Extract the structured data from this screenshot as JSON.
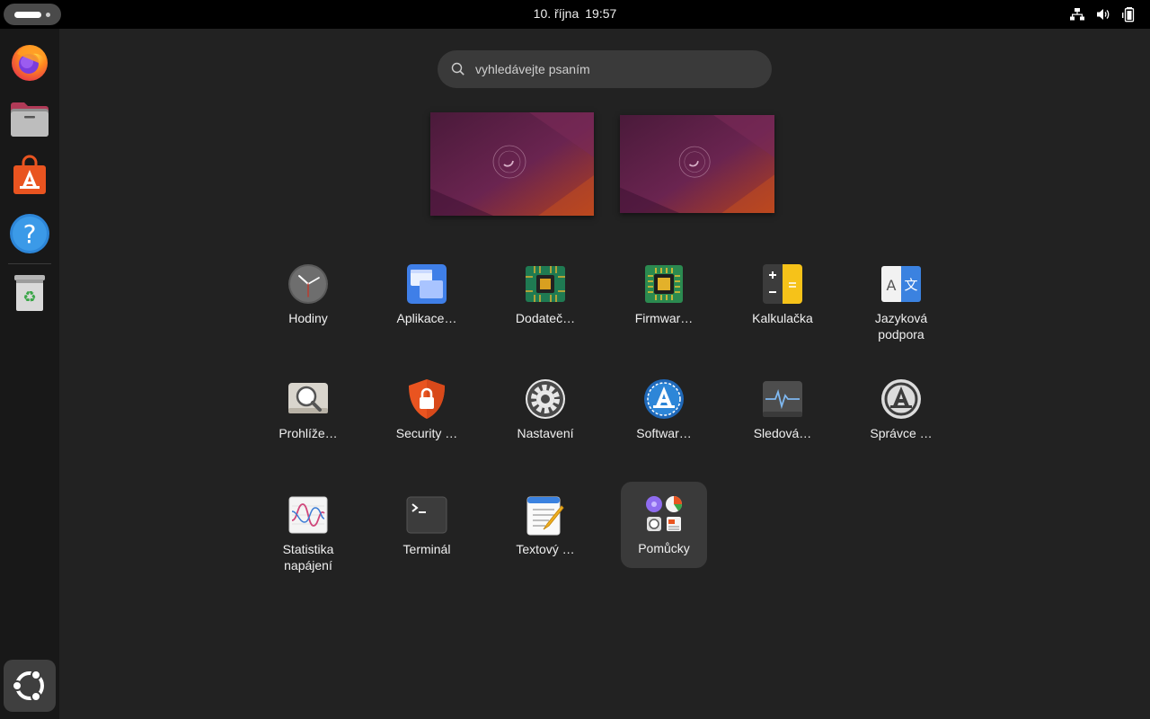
{
  "topbar": {
    "date": "10. října",
    "time": "19:57",
    "tray_icons": [
      "network-wired-icon",
      "volume-icon",
      "battery-icon"
    ]
  },
  "dock": {
    "items": [
      {
        "name": "Firefox",
        "icon": "firefox-icon"
      },
      {
        "name": "Soubory",
        "icon": "files-icon"
      },
      {
        "name": "App Center",
        "icon": "app-center-icon"
      },
      {
        "name": "Nápověda",
        "icon": "help-icon"
      },
      {
        "name": "Koš",
        "icon": "trash-icon"
      }
    ],
    "show_apps_icon": "ubuntu-show-apps-icon"
  },
  "search": {
    "placeholder": "vyhledávejte psaním",
    "value": ""
  },
  "workspaces": 2,
  "apps": [
    {
      "label": "Hodiny",
      "icon": "clock-icon"
    },
    {
      "label": "Aplikace…",
      "icon": "apps-window-icon"
    },
    {
      "label": "Dodateč…",
      "icon": "chip-drivers-icon"
    },
    {
      "label": "Firmwar…",
      "icon": "firmware-chip-icon"
    },
    {
      "label": "Kalkulačka",
      "icon": "calculator-icon"
    },
    {
      "label": "Jazyková podpora",
      "icon": "language-icon"
    },
    {
      "label": "Prohlíže…",
      "icon": "image-viewer-icon"
    },
    {
      "label": "Security …",
      "icon": "security-shield-icon"
    },
    {
      "label": "Nastavení",
      "icon": "settings-gear-icon"
    },
    {
      "label": "Softwar…",
      "icon": "software-updater-icon"
    },
    {
      "label": "Sledová…",
      "icon": "system-monitor-icon"
    },
    {
      "label": "Správce …",
      "icon": "update-manager-icon"
    },
    {
      "label": "Statistika napájení",
      "icon": "power-stats-icon"
    },
    {
      "label": "Terminál",
      "icon": "terminal-icon"
    },
    {
      "label": "Textový …",
      "icon": "text-editor-icon"
    },
    {
      "label": "Pomůcky",
      "icon": "utilities-folder-icon"
    }
  ],
  "colors": {
    "background": "#222222",
    "topbar": "#000000",
    "dock": "#181818",
    "accent": "#e95420"
  }
}
